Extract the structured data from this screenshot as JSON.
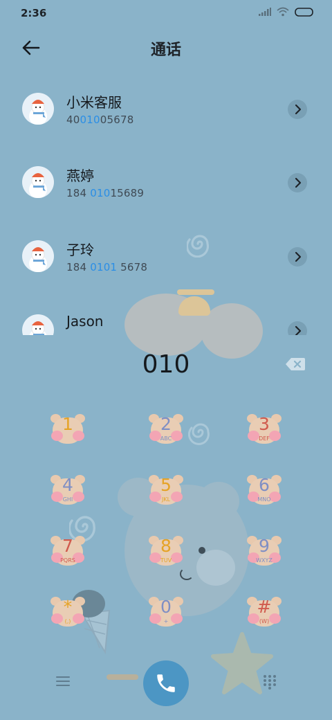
{
  "status_bar": {
    "time": "2:36"
  },
  "header": {
    "title": "通话"
  },
  "contacts": [
    {
      "name": "小米客服",
      "number_pre": "40",
      "number_match": "010",
      "number_post": "05678"
    },
    {
      "name": "燕婷",
      "number_pre": "184 ",
      "number_match": "010",
      "number_post": "15689"
    },
    {
      "name": "子玲",
      "number_pre": "184 ",
      "number_match": "0101",
      "number_post": " 5678"
    },
    {
      "name": "Jason",
      "number_pre": "",
      "number_match": "",
      "number_post": ""
    }
  ],
  "dialer": {
    "input_value": "010",
    "keys": [
      {
        "digit": "1",
        "letters": "",
        "color": "#e5a326"
      },
      {
        "digit": "2",
        "letters": "ABC",
        "color": "#7f8fc4"
      },
      {
        "digit": "3",
        "letters": "DEF",
        "color": "#d05a4d"
      },
      {
        "digit": "4",
        "letters": "GHI",
        "color": "#7f8fc4"
      },
      {
        "digit": "5",
        "letters": "JKL",
        "color": "#e5a326"
      },
      {
        "digit": "6",
        "letters": "MNO",
        "color": "#7f8fc4"
      },
      {
        "digit": "7",
        "letters": "PQRS",
        "color": "#d05a4d"
      },
      {
        "digit": "8",
        "letters": "TUV",
        "color": "#e5a326"
      },
      {
        "digit": "9",
        "letters": "WXYZ",
        "color": "#7f8fc4"
      },
      {
        "digit": "*",
        "letters": "(,)",
        "color": "#e5a326"
      },
      {
        "digit": "0",
        "letters": "+",
        "color": "#7f8fc4"
      },
      {
        "digit": "#",
        "letters": "(W)",
        "color": "#d05a4d"
      }
    ]
  },
  "colors": {
    "background": "#8ab3c9",
    "highlight": "#2a8ee6",
    "call_button": "#4c96c4"
  }
}
